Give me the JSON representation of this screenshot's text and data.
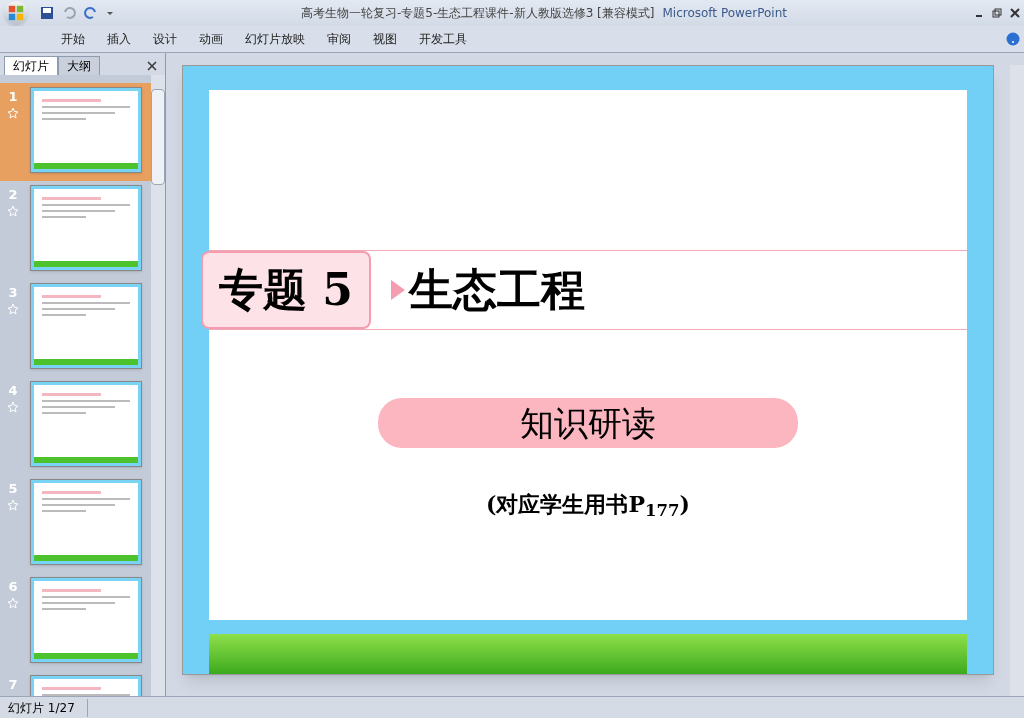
{
  "window": {
    "title": "高考生物一轮复习-专题5-生态工程课件-新人教版选修3 [兼容模式]",
    "app_name": "Microsoft PowerPoint"
  },
  "ribbon_tabs": [
    {
      "label": "开始",
      "selected": false
    },
    {
      "label": "插入",
      "selected": false
    },
    {
      "label": "设计",
      "selected": false
    },
    {
      "label": "动画",
      "selected": false
    },
    {
      "label": "幻灯片放映",
      "selected": false
    },
    {
      "label": "审阅",
      "selected": false
    },
    {
      "label": "视图",
      "selected": false
    },
    {
      "label": "开发工具",
      "selected": false
    }
  ],
  "panel_tabs": [
    {
      "label": "幻灯片",
      "selected": true
    },
    {
      "label": "大纲",
      "selected": false
    }
  ],
  "slides": [
    {
      "number": "1",
      "selected": true
    },
    {
      "number": "2",
      "selected": false
    },
    {
      "number": "3",
      "selected": false
    },
    {
      "number": "4",
      "selected": false
    },
    {
      "number": "5",
      "selected": false
    },
    {
      "number": "6",
      "selected": false
    },
    {
      "number": "7",
      "selected": false
    }
  ],
  "slide": {
    "badge": "专题 5",
    "title": "生态工程",
    "banner": "知识研读",
    "reference": "(对应学生用书P$_{177}$)"
  },
  "status_bar": {
    "slide_count": "幻灯片 1/27"
  }
}
